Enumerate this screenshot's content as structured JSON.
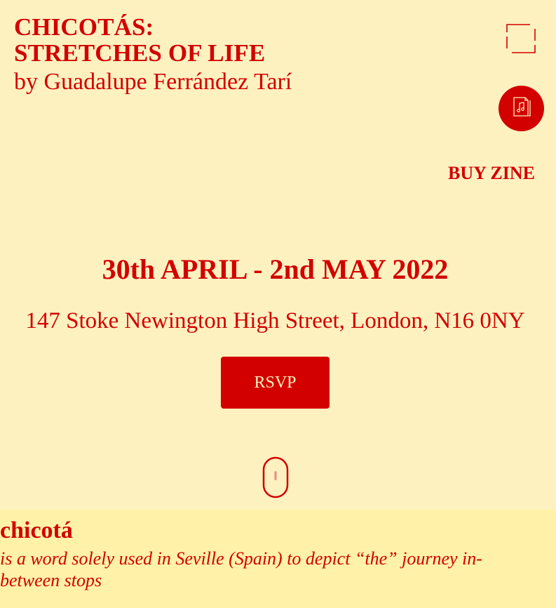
{
  "header": {
    "title_line1": "CHICOTÁS:",
    "title_line2": "STRETCHES OF LIFE",
    "byline": "by Guadalupe Ferrández Tarí"
  },
  "icons": {
    "frame": "frame-corners-icon",
    "music": "music-file-icon",
    "scroll": "mouse-scroll-icon"
  },
  "nav": {
    "buy_zine": "BUY ZINE"
  },
  "event": {
    "dates": "30th APRIL - 2nd MAY 2022",
    "address": "147 Stoke Newington High Street, London, N16 0NY",
    "rsvp_label": "RSVP"
  },
  "definition": {
    "word": "chicotá",
    "text": "is a word solely used in Seville (Spain) to depict “the” journey in-between stops"
  },
  "colors": {
    "background": "#fdf1c0",
    "accent": "#d30000",
    "definition_background": "#fff2a8"
  }
}
